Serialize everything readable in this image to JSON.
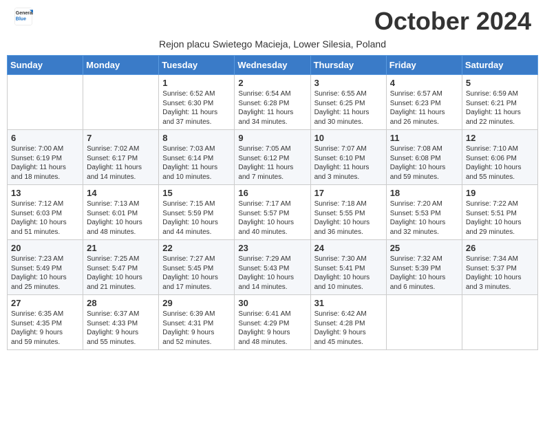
{
  "header": {
    "logo_general": "General",
    "logo_blue": "Blue",
    "month_title": "October 2024",
    "subtitle": "Rejon placu Swietego Macieja, Lower Silesia, Poland"
  },
  "weekdays": [
    "Sunday",
    "Monday",
    "Tuesday",
    "Wednesday",
    "Thursday",
    "Friday",
    "Saturday"
  ],
  "weeks": [
    [
      {
        "day": "",
        "info": ""
      },
      {
        "day": "",
        "info": ""
      },
      {
        "day": "1",
        "info": "Sunrise: 6:52 AM\nSunset: 6:30 PM\nDaylight: 11 hours\nand 37 minutes."
      },
      {
        "day": "2",
        "info": "Sunrise: 6:54 AM\nSunset: 6:28 PM\nDaylight: 11 hours\nand 34 minutes."
      },
      {
        "day": "3",
        "info": "Sunrise: 6:55 AM\nSunset: 6:25 PM\nDaylight: 11 hours\nand 30 minutes."
      },
      {
        "day": "4",
        "info": "Sunrise: 6:57 AM\nSunset: 6:23 PM\nDaylight: 11 hours\nand 26 minutes."
      },
      {
        "day": "5",
        "info": "Sunrise: 6:59 AM\nSunset: 6:21 PM\nDaylight: 11 hours\nand 22 minutes."
      }
    ],
    [
      {
        "day": "6",
        "info": "Sunrise: 7:00 AM\nSunset: 6:19 PM\nDaylight: 11 hours\nand 18 minutes."
      },
      {
        "day": "7",
        "info": "Sunrise: 7:02 AM\nSunset: 6:17 PM\nDaylight: 11 hours\nand 14 minutes."
      },
      {
        "day": "8",
        "info": "Sunrise: 7:03 AM\nSunset: 6:14 PM\nDaylight: 11 hours\nand 10 minutes."
      },
      {
        "day": "9",
        "info": "Sunrise: 7:05 AM\nSunset: 6:12 PM\nDaylight: 11 hours\nand 7 minutes."
      },
      {
        "day": "10",
        "info": "Sunrise: 7:07 AM\nSunset: 6:10 PM\nDaylight: 11 hours\nand 3 minutes."
      },
      {
        "day": "11",
        "info": "Sunrise: 7:08 AM\nSunset: 6:08 PM\nDaylight: 10 hours\nand 59 minutes."
      },
      {
        "day": "12",
        "info": "Sunrise: 7:10 AM\nSunset: 6:06 PM\nDaylight: 10 hours\nand 55 minutes."
      }
    ],
    [
      {
        "day": "13",
        "info": "Sunrise: 7:12 AM\nSunset: 6:03 PM\nDaylight: 10 hours\nand 51 minutes."
      },
      {
        "day": "14",
        "info": "Sunrise: 7:13 AM\nSunset: 6:01 PM\nDaylight: 10 hours\nand 48 minutes."
      },
      {
        "day": "15",
        "info": "Sunrise: 7:15 AM\nSunset: 5:59 PM\nDaylight: 10 hours\nand 44 minutes."
      },
      {
        "day": "16",
        "info": "Sunrise: 7:17 AM\nSunset: 5:57 PM\nDaylight: 10 hours\nand 40 minutes."
      },
      {
        "day": "17",
        "info": "Sunrise: 7:18 AM\nSunset: 5:55 PM\nDaylight: 10 hours\nand 36 minutes."
      },
      {
        "day": "18",
        "info": "Sunrise: 7:20 AM\nSunset: 5:53 PM\nDaylight: 10 hours\nand 32 minutes."
      },
      {
        "day": "19",
        "info": "Sunrise: 7:22 AM\nSunset: 5:51 PM\nDaylight: 10 hours\nand 29 minutes."
      }
    ],
    [
      {
        "day": "20",
        "info": "Sunrise: 7:23 AM\nSunset: 5:49 PM\nDaylight: 10 hours\nand 25 minutes."
      },
      {
        "day": "21",
        "info": "Sunrise: 7:25 AM\nSunset: 5:47 PM\nDaylight: 10 hours\nand 21 minutes."
      },
      {
        "day": "22",
        "info": "Sunrise: 7:27 AM\nSunset: 5:45 PM\nDaylight: 10 hours\nand 17 minutes."
      },
      {
        "day": "23",
        "info": "Sunrise: 7:29 AM\nSunset: 5:43 PM\nDaylight: 10 hours\nand 14 minutes."
      },
      {
        "day": "24",
        "info": "Sunrise: 7:30 AM\nSunset: 5:41 PM\nDaylight: 10 hours\nand 10 minutes."
      },
      {
        "day": "25",
        "info": "Sunrise: 7:32 AM\nSunset: 5:39 PM\nDaylight: 10 hours\nand 6 minutes."
      },
      {
        "day": "26",
        "info": "Sunrise: 7:34 AM\nSunset: 5:37 PM\nDaylight: 10 hours\nand 3 minutes."
      }
    ],
    [
      {
        "day": "27",
        "info": "Sunrise: 6:35 AM\nSunset: 4:35 PM\nDaylight: 9 hours\nand 59 minutes."
      },
      {
        "day": "28",
        "info": "Sunrise: 6:37 AM\nSunset: 4:33 PM\nDaylight: 9 hours\nand 55 minutes."
      },
      {
        "day": "29",
        "info": "Sunrise: 6:39 AM\nSunset: 4:31 PM\nDaylight: 9 hours\nand 52 minutes."
      },
      {
        "day": "30",
        "info": "Sunrise: 6:41 AM\nSunset: 4:29 PM\nDaylight: 9 hours\nand 48 minutes."
      },
      {
        "day": "31",
        "info": "Sunrise: 6:42 AM\nSunset: 4:28 PM\nDaylight: 9 hours\nand 45 minutes."
      },
      {
        "day": "",
        "info": ""
      },
      {
        "day": "",
        "info": ""
      }
    ]
  ]
}
